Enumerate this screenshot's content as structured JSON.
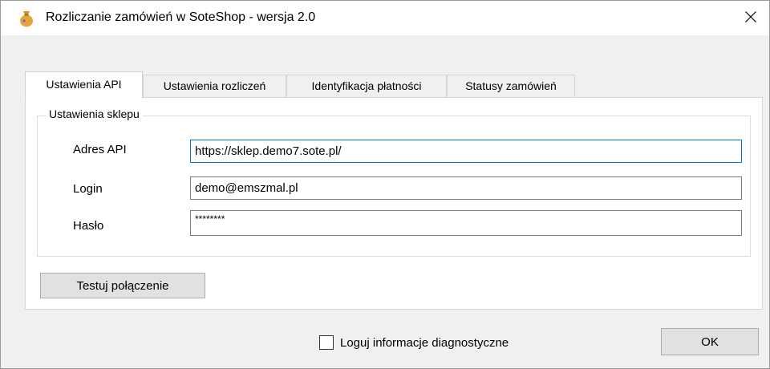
{
  "window": {
    "title": "Rozliczanie zamówień w SoteShop - wersja 2.0",
    "close_glyph": "✕"
  },
  "tabs": [
    {
      "label": "Ustawienia API",
      "active": true
    },
    {
      "label": "Ustawienia rozliczeń",
      "active": false
    },
    {
      "label": "Identyfikacja płatności",
      "active": false
    },
    {
      "label": "Statusy zamówień",
      "active": false
    }
  ],
  "shop_settings": {
    "group_title": "Ustawienia sklepu",
    "api_address": {
      "label": "Adres API",
      "value": "https://sklep.demo7.sote.pl/"
    },
    "login": {
      "label": "Login",
      "value": "demo@emszmal.pl"
    },
    "password": {
      "label": "Hasło",
      "value": "********"
    }
  },
  "test_connection_label": "Testuj połączenie",
  "diagnostics": {
    "label": "Loguj informacje diagnostyczne",
    "checked": false
  },
  "ok_label": "OK",
  "icons": {
    "app": "money-bag-icon",
    "close": "close-icon"
  },
  "colors": {
    "focus_border": "#0078d7",
    "app_icon": "#e8a33a"
  }
}
